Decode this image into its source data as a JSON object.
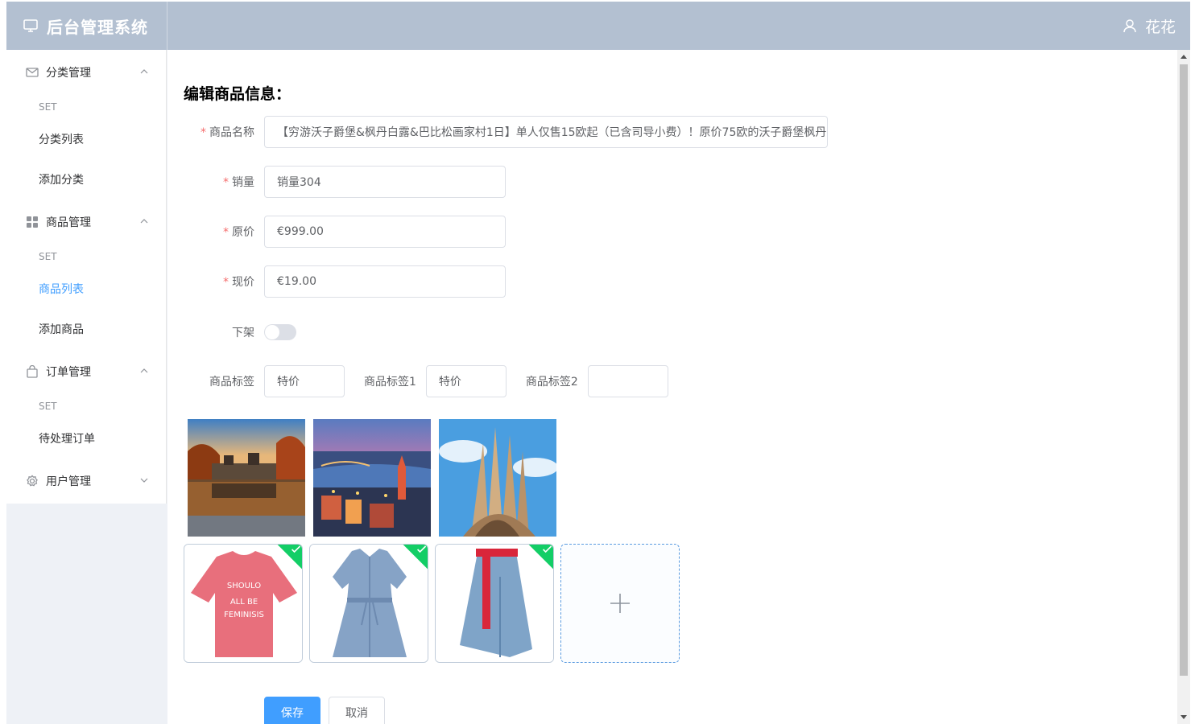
{
  "header": {
    "title": "后台管理系统",
    "user": "花花",
    "icons": {
      "logo": "monitor-icon",
      "user": "user-icon"
    }
  },
  "sidebar": {
    "menus": [
      {
        "title": "分类管理",
        "icon": "message-icon",
        "group": "SET",
        "items": [
          "分类列表",
          "添加分类"
        ]
      },
      {
        "title": "商品管理",
        "icon": "grid-icon",
        "group": "SET",
        "items": [
          "商品列表",
          "添加商品"
        ],
        "active_item": "商品列表"
      },
      {
        "title": "订单管理",
        "icon": "bag-icon",
        "group": "SET",
        "items": [
          "待处理订单"
        ]
      },
      {
        "title": "用户管理",
        "icon": "settings-icon"
      }
    ]
  },
  "form": {
    "page_title": "编辑商品信息：",
    "name_label": "商品名称",
    "name_value": "【穷游沃子爵堡&枫丹白露&巴比松画家村1日】单人仅售15欧起（已含司导小费）！原价75欧的沃子爵堡枫丹",
    "sales_label": "销量",
    "sales_value": "销量304",
    "original_price_label": "原价",
    "original_price_value": "€999.00",
    "current_price_label": "现价",
    "current_price_value": "€19.00",
    "off_shelf_label": "下架",
    "off_shelf_on": false,
    "tag_label": "商品标签",
    "tag_value": "特价",
    "tag1_label": "商品标签1",
    "tag1_value": "特价",
    "tag2_label": "商品标签2",
    "tag2_value": ""
  },
  "images": {
    "gallery": [
      "chateau-lake-photo",
      "city-river-night-photo",
      "sagrada-familia-photo"
    ],
    "uploaded": [
      "pink-tshirt-photo",
      "blue-shirt-dress-photo",
      "denim-skirt-photo"
    ],
    "add_icon": "plus-icon"
  },
  "buttons": {
    "save": "保存",
    "cancel": "取消"
  },
  "colors": {
    "header_bg": "#b3c0d1",
    "primary": "#409eff",
    "active_menu": "#409eff",
    "success": "#13ce66",
    "required": "#f56c6c"
  }
}
